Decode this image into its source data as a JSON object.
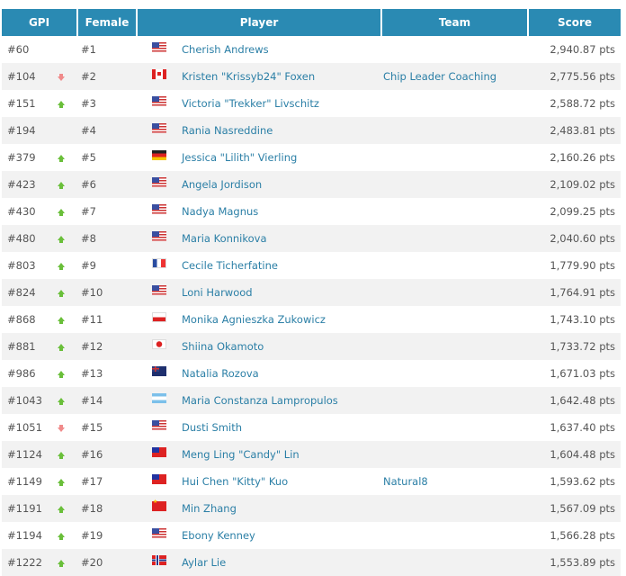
{
  "headers": {
    "gpi": "GPI",
    "female": "Female",
    "player": "Player",
    "team": "Team",
    "score": "Score"
  },
  "rows": [
    {
      "gpi": "#60",
      "trend": "none",
      "female": "#1",
      "flag": "us",
      "player": "Cherish Andrews",
      "team": "",
      "score": "2,940.87 pts"
    },
    {
      "gpi": "#104",
      "trend": "down",
      "female": "#2",
      "flag": "ca",
      "player": "Kristen \"Krissyb24\" Foxen",
      "team": "Chip Leader Coaching",
      "score": "2,775.56 pts"
    },
    {
      "gpi": "#151",
      "trend": "up",
      "female": "#3",
      "flag": "us",
      "player": "Victoria \"Trekker\" Livschitz",
      "team": "",
      "score": "2,588.72 pts"
    },
    {
      "gpi": "#194",
      "trend": "none",
      "female": "#4",
      "flag": "us",
      "player": "Rania Nasreddine",
      "team": "",
      "score": "2,483.81 pts"
    },
    {
      "gpi": "#379",
      "trend": "up",
      "female": "#5",
      "flag": "de",
      "player": "Jessica \"Lilith\" Vierling",
      "team": "",
      "score": "2,160.26 pts"
    },
    {
      "gpi": "#423",
      "trend": "up",
      "female": "#6",
      "flag": "us",
      "player": "Angela Jordison",
      "team": "",
      "score": "2,109.02 pts"
    },
    {
      "gpi": "#430",
      "trend": "up",
      "female": "#7",
      "flag": "us",
      "player": "Nadya Magnus",
      "team": "",
      "score": "2,099.25 pts"
    },
    {
      "gpi": "#480",
      "trend": "up",
      "female": "#8",
      "flag": "us",
      "player": "Maria Konnikova",
      "team": "",
      "score": "2,040.60 pts"
    },
    {
      "gpi": "#803",
      "trend": "up",
      "female": "#9",
      "flag": "fr",
      "player": "Cecile Ticherfatine",
      "team": "",
      "score": "1,779.90 pts"
    },
    {
      "gpi": "#824",
      "trend": "up",
      "female": "#10",
      "flag": "us",
      "player": "Loni Harwood",
      "team": "",
      "score": "1,764.91 pts"
    },
    {
      "gpi": "#868",
      "trend": "up",
      "female": "#11",
      "flag": "pl",
      "player": "Monika Agnieszka Zukowicz",
      "team": "",
      "score": "1,743.10 pts"
    },
    {
      "gpi": "#881",
      "trend": "up",
      "female": "#12",
      "flag": "jp",
      "player": "Shiina Okamoto",
      "team": "",
      "score": "1,733.72 pts"
    },
    {
      "gpi": "#986",
      "trend": "up",
      "female": "#13",
      "flag": "nz",
      "player": "Natalia Rozova",
      "team": "",
      "score": "1,671.03 pts"
    },
    {
      "gpi": "#1043",
      "trend": "up",
      "female": "#14",
      "flag": "ar",
      "player": "Maria Constanza Lampropulos",
      "team": "",
      "score": "1,642.48 pts"
    },
    {
      "gpi": "#1051",
      "trend": "down",
      "female": "#15",
      "flag": "us",
      "player": "Dusti Smith",
      "team": "",
      "score": "1,637.40 pts"
    },
    {
      "gpi": "#1124",
      "trend": "up",
      "female": "#16",
      "flag": "tw",
      "player": "Meng Ling \"Candy\" Lin",
      "team": "",
      "score": "1,604.48 pts"
    },
    {
      "gpi": "#1149",
      "trend": "up",
      "female": "#17",
      "flag": "tw",
      "player": "Hui Chen \"Kitty\" Kuo",
      "team": "Natural8",
      "score": "1,593.62 pts"
    },
    {
      "gpi": "#1191",
      "trend": "up",
      "female": "#18",
      "flag": "cn",
      "player": "Min Zhang",
      "team": "",
      "score": "1,567.09 pts"
    },
    {
      "gpi": "#1194",
      "trend": "up",
      "female": "#19",
      "flag": "us",
      "player": "Ebony Kenney",
      "team": "",
      "score": "1,566.28 pts"
    },
    {
      "gpi": "#1222",
      "trend": "up",
      "female": "#20",
      "flag": "no",
      "player": "Aylar Lie",
      "team": "",
      "score": "1,553.89 pts"
    }
  ]
}
